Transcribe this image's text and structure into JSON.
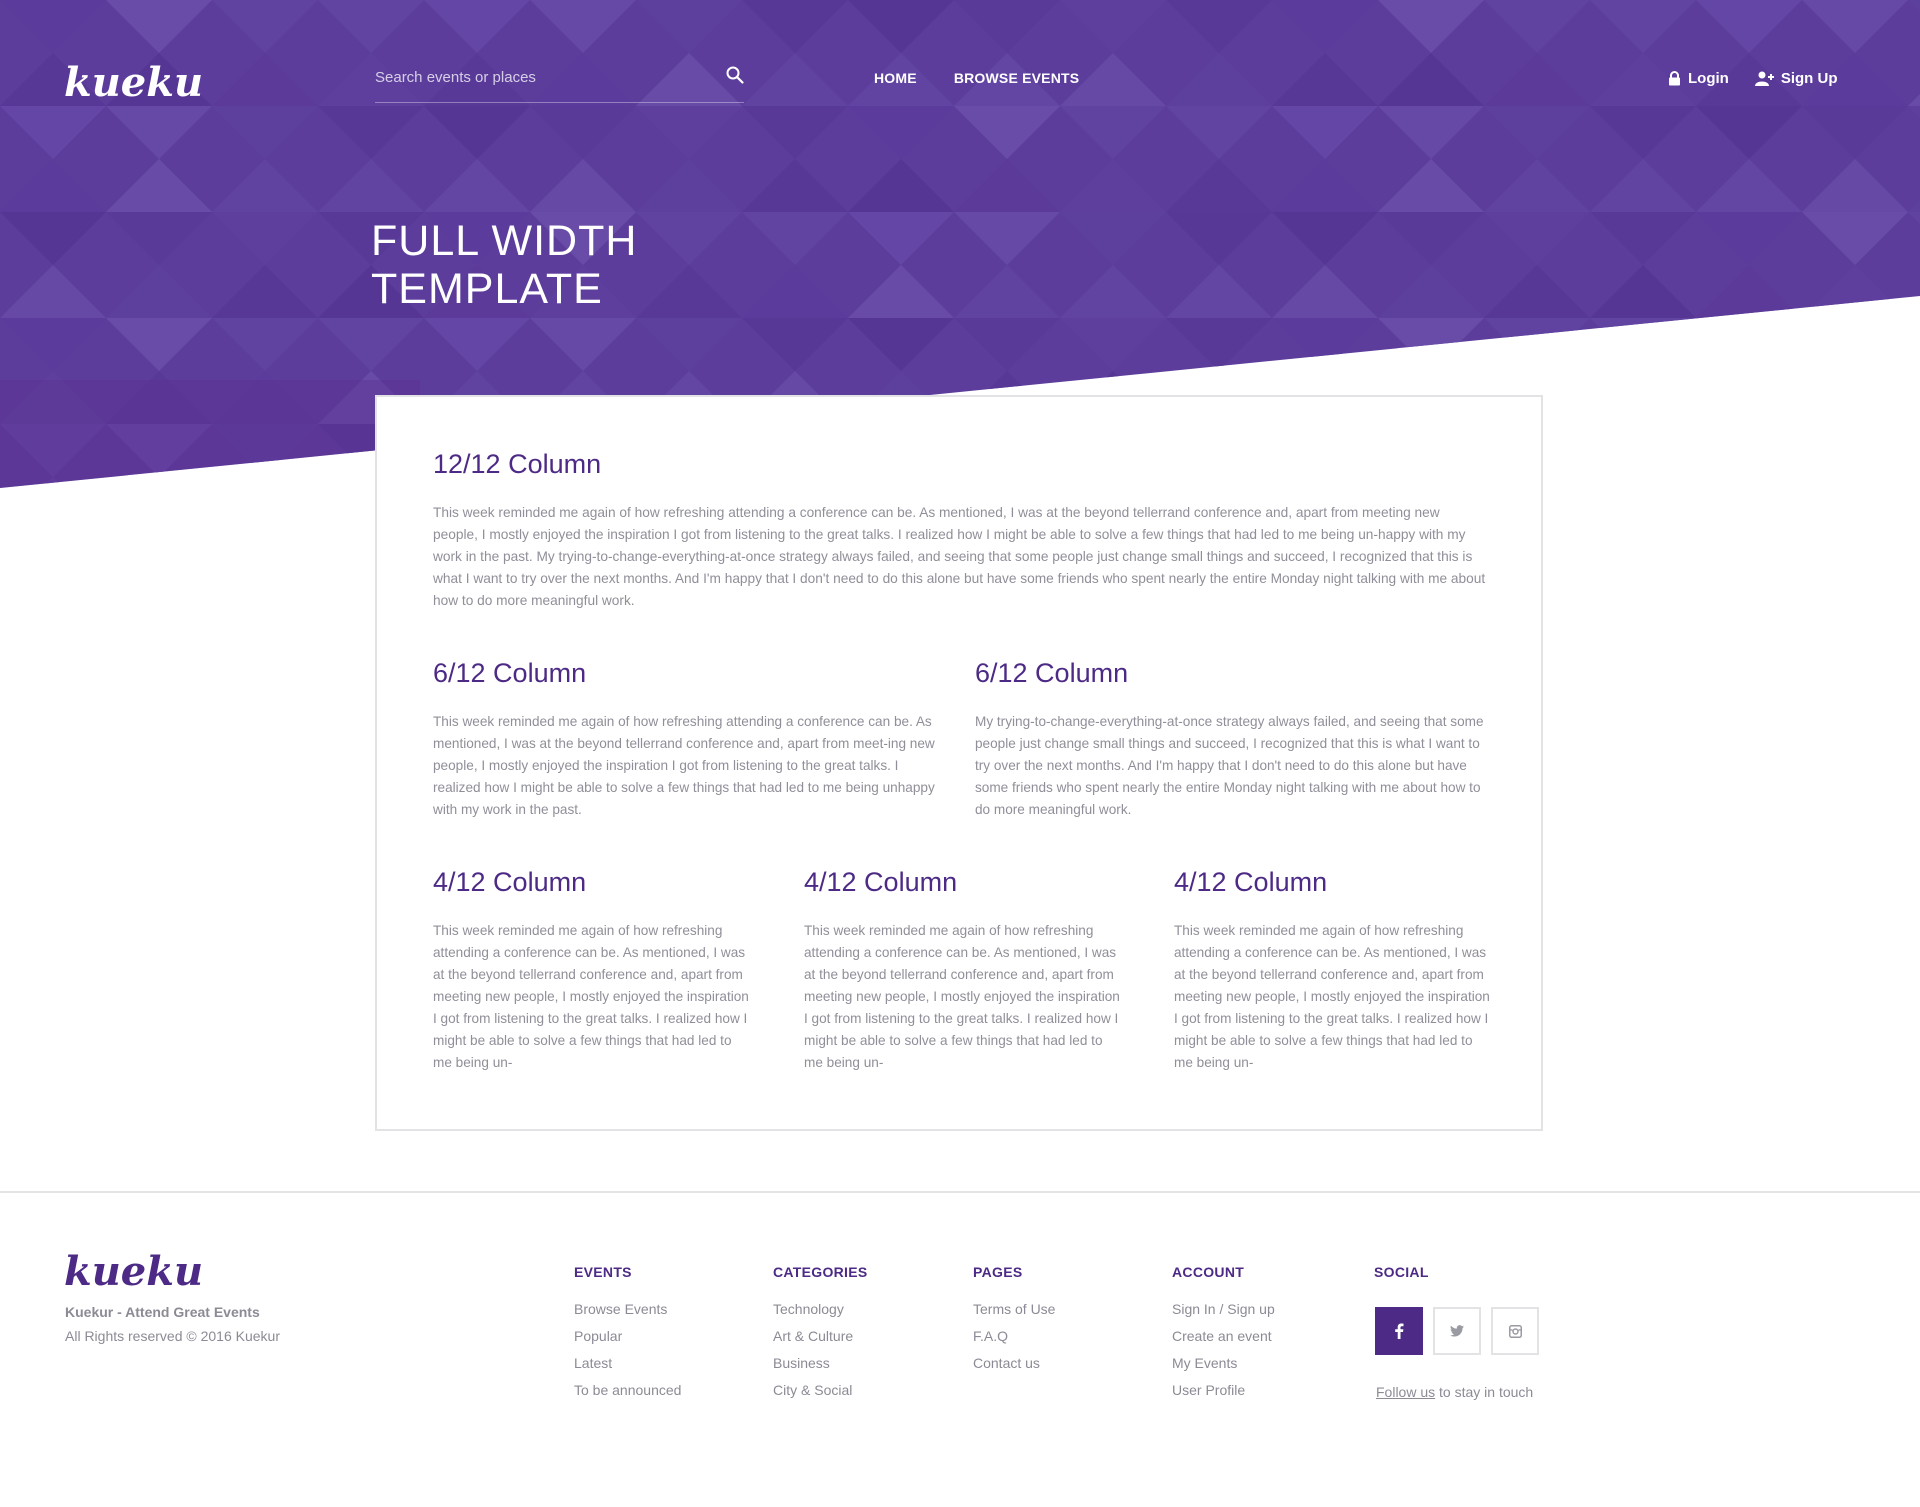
{
  "header": {
    "logo_text": "kuekur",
    "search": {
      "placeholder": "Search events or places",
      "value": ""
    },
    "nav": {
      "home": "HOME",
      "browse": "BROWSE EVENTS"
    },
    "auth": {
      "login": "Login",
      "signup": "Sign Up"
    },
    "title_line1": "FULL WIDTH",
    "title_line2": "TEMPLATE"
  },
  "content": {
    "full": {
      "heading": "12/12 Column",
      "text": "This week reminded me again of how refreshing attending a conference can be. As mentioned, I was at the beyond tellerrand conference and, apart from meeting new people, I mostly enjoyed the inspiration I got from listening to the great talks. I realized how I might be able to solve a few things that had led to me being un-happy with my work in the past. My trying-to-change-everything-at-once strategy always failed, and seeing that some people just change small things and succeed, I recognized that this is what I want to try over the next months. And I'm happy that I don't need to do this alone but have some friends who spent nearly the entire Monday night talking with me about how to do more meaningful work."
    },
    "half": [
      {
        "heading": "6/12 Column",
        "text": "This week reminded me again of how refreshing attending a conference can be. As mentioned, I was at the beyond tellerrand conference and, apart from meet-ing new people, I mostly enjoyed the inspiration I got from listening to the great talks. I realized how I might be able to solve a few things that had led to me being unhappy with my work in the past."
      },
      {
        "heading": "6/12 Column",
        "text": "My trying-to-change-everything-at-once strategy always failed, and seeing that some people just change small things and succeed, I recognized that this is what I want to try over the next months. And I'm happy that I don't need to do this alone but have some friends who spent nearly the entire Monday night talking with me about how to do more meaningful work."
      }
    ],
    "third": [
      {
        "heading": "4/12 Column",
        "text": "This week reminded me again of how refreshing attending a conference can be. As mentioned, I was at the beyond tellerrand conference and, apart from meeting new people, I mostly enjoyed the inspiration I got from listening to the great talks. I realized how I might be able to solve a few things that had led to me being un-"
      },
      {
        "heading": "4/12 Column",
        "text": "This week reminded me again of how refreshing attending a conference can be. As mentioned, I was at the beyond tellerrand conference and, apart from meeting new people, I mostly enjoyed the inspiration I got from listening to the great talks. I realized how I might be able to solve a few things that had led to me being un-"
      },
      {
        "heading": "4/12 Column",
        "text": "This week reminded me again of how refreshing attending a conference can be. As mentioned, I was at the beyond tellerrand conference and, apart from meeting new people, I mostly enjoyed the inspiration I got from listening to the great talks. I realized how I might be able to solve a few things that had led to me being un-"
      }
    ]
  },
  "footer": {
    "logo_text": "kuekur",
    "tagline": "Kuekur - Attend Great Events",
    "copyright": "All Rights reserved © 2016 Kuekur",
    "columns": {
      "events": {
        "title": "EVENTS",
        "links": [
          "Browse Events",
          "Popular",
          "Latest",
          "To be announced"
        ]
      },
      "categories": {
        "title": "CATEGORIES",
        "links": [
          "Technology",
          "Art & Culture",
          "Business",
          "City & Social"
        ]
      },
      "pages": {
        "title": "PAGES",
        "links": [
          "Terms of Use",
          "F.A.Q",
          "Contact us"
        ]
      },
      "account": {
        "title": "ACCOUNT",
        "links": [
          "Sign In / Sign up",
          "Create an event",
          "My Events",
          "User Profile"
        ]
      }
    },
    "social": {
      "title": "SOCIAL",
      "buttons": [
        "facebook-icon",
        "twitter-icon",
        "instagram-icon"
      ],
      "follow_link": "Follow us",
      "follow_rest": "to stay in touch"
    }
  },
  "colors": {
    "hero_purple": "#5a3a9a",
    "accent_purple": "#4c2a85",
    "text_gray": "#8b8b95"
  }
}
